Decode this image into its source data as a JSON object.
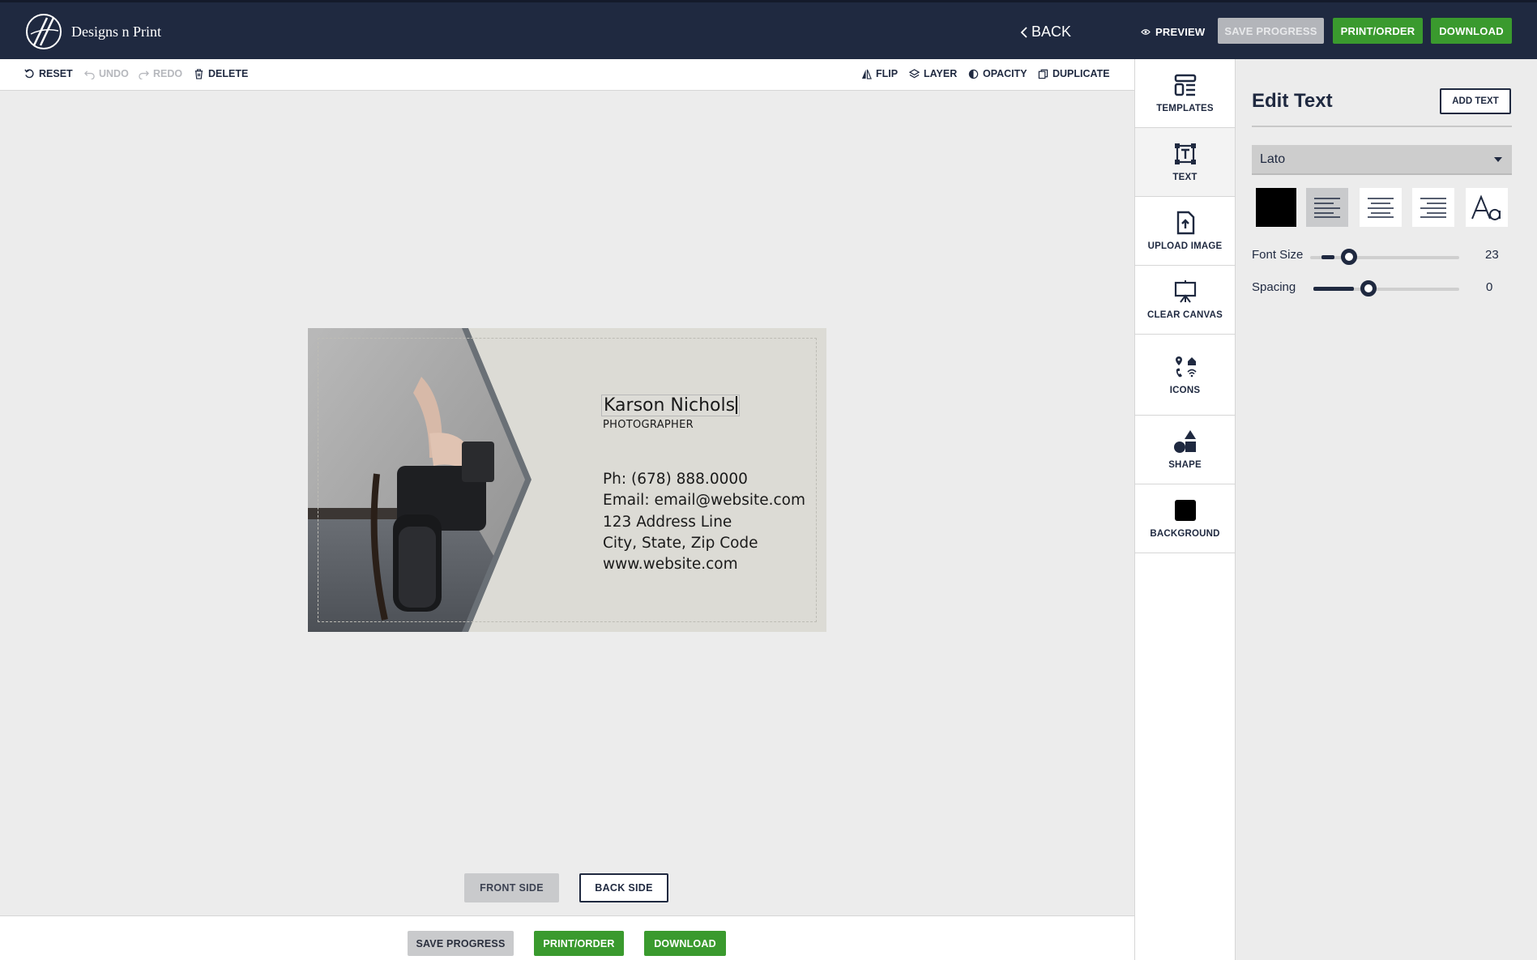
{
  "brand": {
    "name": "Designs n Print"
  },
  "topbar": {
    "back_label": "BACK",
    "preview_label": "PREVIEW",
    "save_label": "SAVE PROGRESS",
    "print_label": "PRINT/ORDER",
    "download_label": "DOWNLOAD"
  },
  "toolbar": {
    "reset": "RESET",
    "undo": "UNDO",
    "redo": "REDO",
    "delete": "DELETE",
    "flip": "FLIP",
    "layer": "LAYER",
    "opacity": "OPACITY",
    "duplicate": "DUPLICATE"
  },
  "card": {
    "name": "Karson Nichols",
    "title": "PHOTOGRAPHER",
    "lines": [
      "Ph: (678) 888.0000",
      "Email: email@website.com",
      "123 Address Line",
      "City, State, Zip Code",
      "www.website.com"
    ]
  },
  "sides": {
    "front": "FRONT SIDE",
    "back": "BACK SIDE"
  },
  "bottombar": {
    "save_label": "SAVE PROGRESS",
    "print_label": "PRINT/ORDER",
    "download_label": "DOWNLOAD"
  },
  "rail": {
    "items": [
      {
        "label": "TEMPLATES",
        "icon": "templates-icon"
      },
      {
        "label": "TEXT",
        "icon": "text-icon"
      },
      {
        "label": "UPLOAD IMAGE",
        "icon": "upload-image-icon"
      },
      {
        "label": "CLEAR CANVAS",
        "icon": "clear-canvas-icon"
      },
      {
        "label": "ICONS",
        "icon": "icons-icon"
      },
      {
        "label": "SHAPE",
        "icon": "shape-icon"
      },
      {
        "label": "BACKGROUND",
        "icon": "background-icon"
      }
    ],
    "active": "TEXT"
  },
  "panel": {
    "title": "Edit Text",
    "add_text_label": "ADD TEXT",
    "font": "Lato",
    "text_color": "#000000",
    "alignment": "left",
    "font_size_label": "Font Size",
    "font_size_value": "23",
    "spacing_label": "Spacing",
    "spacing_value": "0"
  },
  "colors": {
    "navy": "#1f2940",
    "green": "#3a9a2e",
    "grey_button": "#b3b5ba",
    "card_background": "#dcdbd5"
  }
}
